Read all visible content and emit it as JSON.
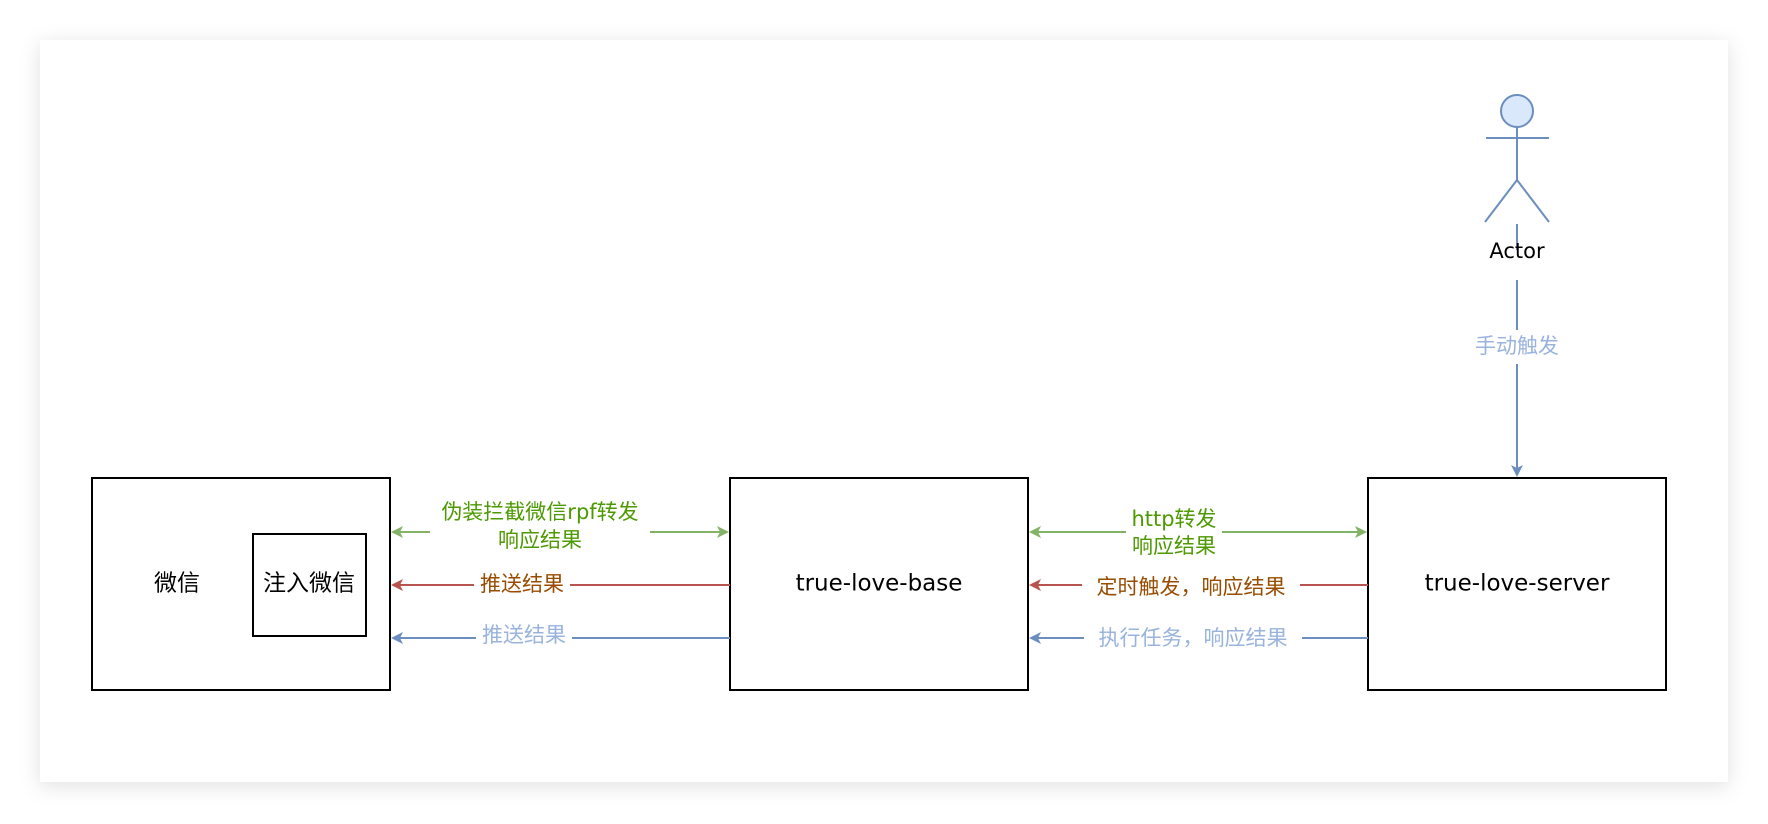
{
  "nodes": {
    "wechat": {
      "label": "微信"
    },
    "inject_wechat": {
      "label": "注入微信"
    },
    "true_love_base": {
      "label": "true-love-base"
    },
    "true_love_server": {
      "label": "true-love-server"
    },
    "actor": {
      "label": "Actor"
    }
  },
  "edges": {
    "wechat_base_forward": {
      "line1": "伪装拦截微信rpf转发",
      "line2": "响应结果",
      "direction": "bidirectional",
      "color": "#82b366",
      "text_color": "#4d9900"
    },
    "base_to_wechat_push_red": {
      "label": "推送结果",
      "direction": "to-wechat",
      "color": "#b85450",
      "text_color": "#994c00"
    },
    "base_to_wechat_push_blue": {
      "label": "推送结果",
      "direction": "to-wechat",
      "color": "#6c8ebf",
      "text_color": "#99b3dd"
    },
    "base_server_http": {
      "line1": "http转发",
      "line2": "响应结果",
      "direction": "bidirectional",
      "color": "#82b366",
      "text_color": "#4d9900"
    },
    "server_to_base_timer": {
      "label": "定时触发，响应结果",
      "direction": "to-base",
      "color": "#b85450",
      "text_color": "#994c00"
    },
    "server_to_base_task": {
      "label": "执行任务，响应结果",
      "direction": "to-base",
      "color": "#6c8ebf",
      "text_color": "#99b3dd"
    },
    "actor_to_server": {
      "label": "手动触发",
      "direction": "to-server",
      "color": "#6c8ebf",
      "text_color": "#99b3dd"
    }
  },
  "colors": {
    "actor_fill": "#dae8fc",
    "actor_stroke": "#6c8ebf",
    "box_stroke": "#000000"
  }
}
